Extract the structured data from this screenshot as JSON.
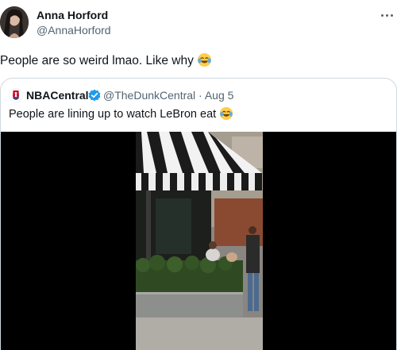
{
  "post": {
    "author_name": "Anna Horford",
    "author_handle": "@AnnaHorford",
    "text": "People are so weird lmao. Like why",
    "emoji": "face-with-tears-of-joy-icon"
  },
  "quote": {
    "author_name": "NBACentral",
    "verified": true,
    "author_handle": "@TheDunkCentral",
    "separator": "·",
    "date": "Aug 5",
    "text": "People are lining up to watch LeBron eat",
    "emoji": "face-with-tears-of-joy-icon",
    "media_type": "video"
  },
  "colors": {
    "text_primary": "#0f1419",
    "text_secondary": "#536471",
    "border": "#cfd9de",
    "verified_blue": "#1d9bf0"
  }
}
